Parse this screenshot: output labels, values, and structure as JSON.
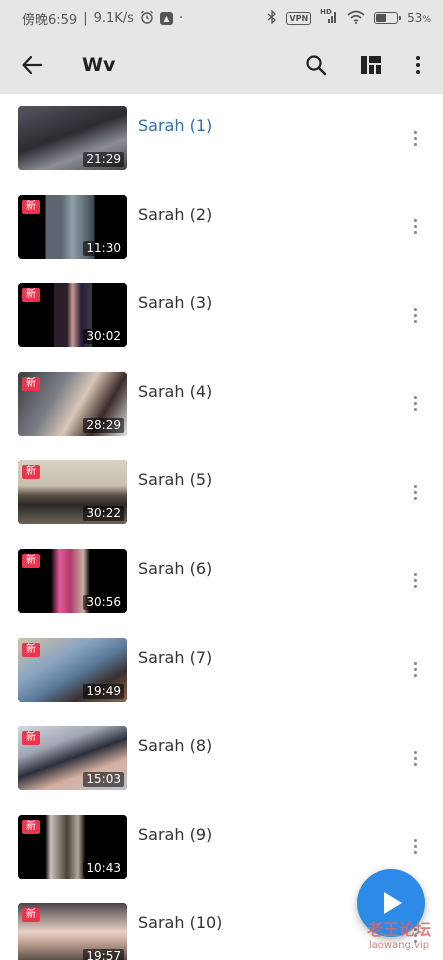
{
  "status_bar": {
    "time": "傍晚6:59",
    "net_speed": "9.1K/s",
    "dot": "·",
    "vpn": "VPN",
    "signal_label": "HD",
    "battery": "53",
    "battery_level": 0.53
  },
  "toolbar": {
    "title": "Wv",
    "icons": [
      "back-arrow-icon",
      "search-icon",
      "layout-grid-icon",
      "more-vert-icon"
    ]
  },
  "videos": [
    {
      "title": "Sarah (1)",
      "duration": "21:29",
      "badge": "",
      "active": true
    },
    {
      "title": "Sarah (2)",
      "duration": "11:30",
      "badge": "新",
      "active": false
    },
    {
      "title": "Sarah (3)",
      "duration": "30:02",
      "badge": "新",
      "active": false
    },
    {
      "title": "Sarah (4)",
      "duration": "28:29",
      "badge": "新",
      "active": false
    },
    {
      "title": "Sarah (5)",
      "duration": "30:22",
      "badge": "新",
      "active": false
    },
    {
      "title": "Sarah (6)",
      "duration": "30:56",
      "badge": "新",
      "active": false
    },
    {
      "title": "Sarah (7)",
      "duration": "19:49",
      "badge": "新",
      "active": false
    },
    {
      "title": "Sarah (8)",
      "duration": "15:03",
      "badge": "新",
      "active": false
    },
    {
      "title": "Sarah (9)",
      "duration": "10:43",
      "badge": "新",
      "active": false
    },
    {
      "title": "Sarah (10)",
      "duration": "19:57",
      "badge": "新",
      "active": false
    }
  ],
  "watermark": {
    "line1": "老王论坛",
    "line2": "laowang.vip"
  },
  "colors": {
    "accent": "#2d8ae6",
    "active_title": "#2e6fb0",
    "badge": "#e8364f",
    "bar_bg": "#e6e6e6"
  }
}
